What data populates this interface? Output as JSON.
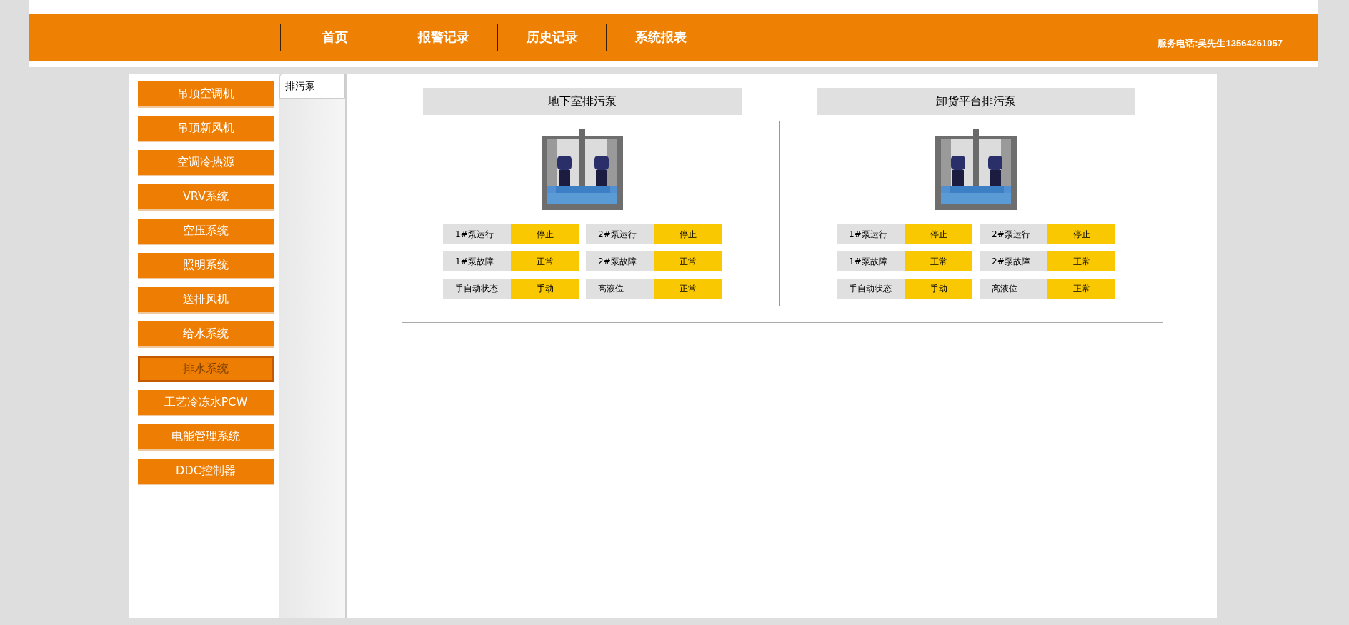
{
  "nav": [
    {
      "label": "首页"
    },
    {
      "label": "报警记录"
    },
    {
      "label": "历史记录"
    },
    {
      "label": "系统报表"
    }
  ],
  "service_phone": "服务电话:吴先生13564261057",
  "sidebar": {
    "items": [
      {
        "label": "吊顶空调机",
        "selected": false
      },
      {
        "label": "吊顶新风机",
        "selected": false
      },
      {
        "label": "空调冷热源",
        "selected": false
      },
      {
        "label": "VRV系统",
        "selected": false
      },
      {
        "label": "空压系统",
        "selected": false
      },
      {
        "label": "照明系统",
        "selected": false
      },
      {
        "label": "送排风机",
        "selected": false
      },
      {
        "label": "给水系统",
        "selected": false
      },
      {
        "label": "排水系统",
        "selected": true
      },
      {
        "label": "工艺冷冻水PCW",
        "selected": false
      },
      {
        "label": "电能管理系统",
        "selected": false
      },
      {
        "label": "DDC控制器",
        "selected": false
      }
    ]
  },
  "tabs": [
    {
      "label": "排污泵",
      "selected": true
    }
  ],
  "panels": [
    {
      "title": "地下室排污泵",
      "statuses": [
        {
          "label": "1#泵运行",
          "value": "停止"
        },
        {
          "label": "2#泵运行",
          "value": "停止"
        },
        {
          "label": "1#泵故障",
          "value": "正常"
        },
        {
          "label": "2#泵故障",
          "value": "正常"
        },
        {
          "label": "手自动状态",
          "value": "手动"
        },
        {
          "label": "高液位",
          "value": "正常"
        }
      ]
    },
    {
      "title": "卸货平台排污泵",
      "statuses": [
        {
          "label": "1#泵运行",
          "value": "停止"
        },
        {
          "label": "2#泵运行",
          "value": "停止"
        },
        {
          "label": "1#泵故障",
          "value": "正常"
        },
        {
          "label": "2#泵故障",
          "value": "正常"
        },
        {
          "label": "手自动状态",
          "value": "手动"
        },
        {
          "label": "高液位",
          "value": "正常"
        }
      ]
    }
  ]
}
